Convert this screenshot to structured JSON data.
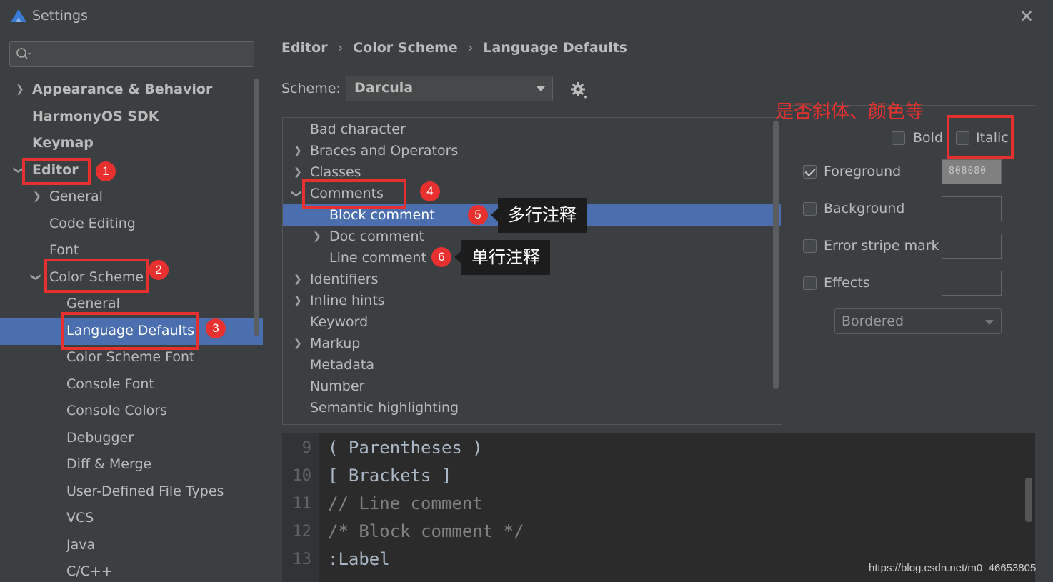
{
  "window": {
    "title": "Settings"
  },
  "search": {
    "placeholder": ""
  },
  "sidebar": {
    "items": [
      {
        "label": "Appearance & Behavior",
        "bold": true,
        "chevron": "right"
      },
      {
        "label": "HarmonyOS SDK",
        "bold": true
      },
      {
        "label": "Keymap",
        "bold": true
      },
      {
        "label": "Editor",
        "bold": true,
        "chevron": "down"
      },
      {
        "label": "General",
        "chevron": "right"
      },
      {
        "label": "Code Editing"
      },
      {
        "label": "Font"
      },
      {
        "label": "Color Scheme",
        "chevron": "down"
      },
      {
        "label": "General"
      },
      {
        "label": "Language Defaults",
        "selected": true
      },
      {
        "label": "Color Scheme Font"
      },
      {
        "label": "Console Font"
      },
      {
        "label": "Console Colors"
      },
      {
        "label": "Debugger"
      },
      {
        "label": "Diff & Merge"
      },
      {
        "label": "User-Defined File Types"
      },
      {
        "label": "VCS"
      },
      {
        "label": "Java"
      },
      {
        "label": "C/C++"
      }
    ]
  },
  "breadcrumb": {
    "items": [
      "Editor",
      "Color Scheme",
      "Language Defaults"
    ],
    "separator": "›"
  },
  "scheme": {
    "label": "Scheme:",
    "value": "Darcula"
  },
  "attributes": {
    "items": [
      {
        "label": "Bad character"
      },
      {
        "label": "Braces and Operators",
        "chevron": "right"
      },
      {
        "label": "Classes",
        "chevron": "right"
      },
      {
        "label": "Comments",
        "chevron": "down"
      },
      {
        "label": "Block comment",
        "selected": true
      },
      {
        "label": "Doc comment",
        "chevron": "right"
      },
      {
        "label": "Line comment"
      },
      {
        "label": "Identifiers",
        "chevron": "right"
      },
      {
        "label": "Inline hints",
        "chevron": "right"
      },
      {
        "label": "Keyword"
      },
      {
        "label": "Markup",
        "chevron": "right"
      },
      {
        "label": "Metadata"
      },
      {
        "label": "Number"
      },
      {
        "label": "Semantic highlighting"
      }
    ]
  },
  "properties": {
    "bold": {
      "label": "Bold",
      "checked": false
    },
    "italic": {
      "label": "Italic",
      "checked": false
    },
    "foreground": {
      "label": "Foreground",
      "checked": true,
      "color": "808080"
    },
    "background": {
      "label": "Background",
      "checked": false
    },
    "error_stripe": {
      "label": "Error stripe mark",
      "checked": false
    },
    "effects": {
      "label": "Effects",
      "checked": false,
      "type": "Bordered"
    }
  },
  "preview": {
    "lines": [
      {
        "num": "9",
        "text": "( Parentheses )",
        "color": "#a9b7c6"
      },
      {
        "num": "10",
        "text": "[ Brackets ]",
        "color": "#a9b7c6"
      },
      {
        "num": "11",
        "text": "// Line comment",
        "color": "#808080"
      },
      {
        "num": "12",
        "text": "/* Block comment */",
        "color": "#808080"
      },
      {
        "num": "13",
        "text": ":Label",
        "color": "#a9b7c6"
      }
    ]
  },
  "annotations": {
    "n1": "1",
    "n2": "2",
    "n3": "3",
    "n4": "4",
    "n5": "5",
    "n6": "6",
    "tip5": "多行注释",
    "tip6": "单行注释",
    "italic_note": "是否斜体、颜色等"
  },
  "watermark": "https://blog.csdn.net/m0_46653805",
  "colors": {
    "accent": "#4b6eaf",
    "background": "#3c3f41",
    "annotation": "#e8312f",
    "editor_bg": "#2b2b2b"
  }
}
